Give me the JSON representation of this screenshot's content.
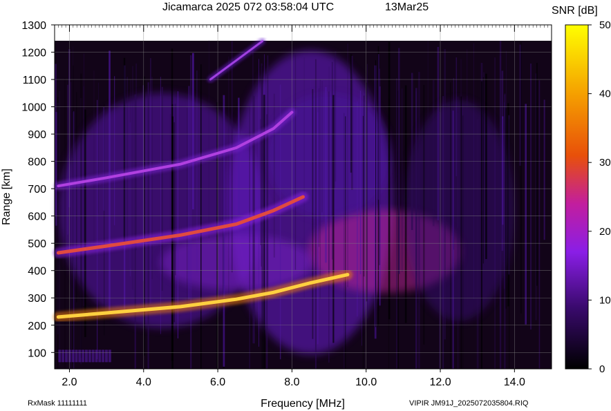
{
  "header": {
    "title": "Jicamarca 2025 072 03:58:04 UTC",
    "date_label": "13Mar25"
  },
  "footer": {
    "rx_mask": "RxMask 11111111",
    "file_label": "VIPIR  JM91J_2025072035804.RIQ"
  },
  "chart_data": {
    "type": "heatmap",
    "xlabel": "Frequency [MHz]",
    "ylabel": "Range [km]",
    "xlim": [
      1.6,
      15.0
    ],
    "ylim": [
      40,
      1300
    ],
    "x_ticks": [
      "2.0",
      "4.0",
      "6.0",
      "8.0",
      "10.0",
      "12.0",
      "14.0"
    ],
    "y_ticks": [
      "100",
      "200",
      "300",
      "400",
      "500",
      "600",
      "700",
      "800",
      "900",
      "1000",
      "1100",
      "1200",
      "1300"
    ],
    "grid": true,
    "colorbar": {
      "label": "SNR [dB]",
      "min": 0,
      "max": 50,
      "ticks": [
        "0",
        "10",
        "20",
        "30",
        "40",
        "50"
      ],
      "colormap": "black-purple-orange-yellow"
    },
    "traces": [
      {
        "name": "",
        "points": [
          [
            1.7,
            230
          ],
          [
            3.0,
            245
          ],
          [
            5.0,
            268
          ],
          [
            6.5,
            295
          ],
          [
            7.5,
            320
          ],
          [
            8.5,
            355
          ],
          [
            9.5,
            385
          ]
        ]
      },
      {
        "name": "",
        "points": [
          [
            1.7,
            465
          ],
          [
            3.0,
            490
          ],
          [
            5.0,
            530
          ],
          [
            6.5,
            570
          ],
          [
            7.5,
            620
          ],
          [
            8.3,
            670
          ]
        ]
      },
      {
        "name": "",
        "points": [
          [
            1.7,
            710
          ],
          [
            3.0,
            740
          ],
          [
            5.0,
            790
          ],
          [
            6.5,
            850
          ],
          [
            7.5,
            920
          ],
          [
            8.0,
            980
          ]
        ]
      },
      {
        "name": "",
        "points": [
          [
            5.8,
            1100
          ],
          [
            6.5,
            1170
          ],
          [
            7.2,
            1240
          ]
        ]
      }
    ]
  }
}
